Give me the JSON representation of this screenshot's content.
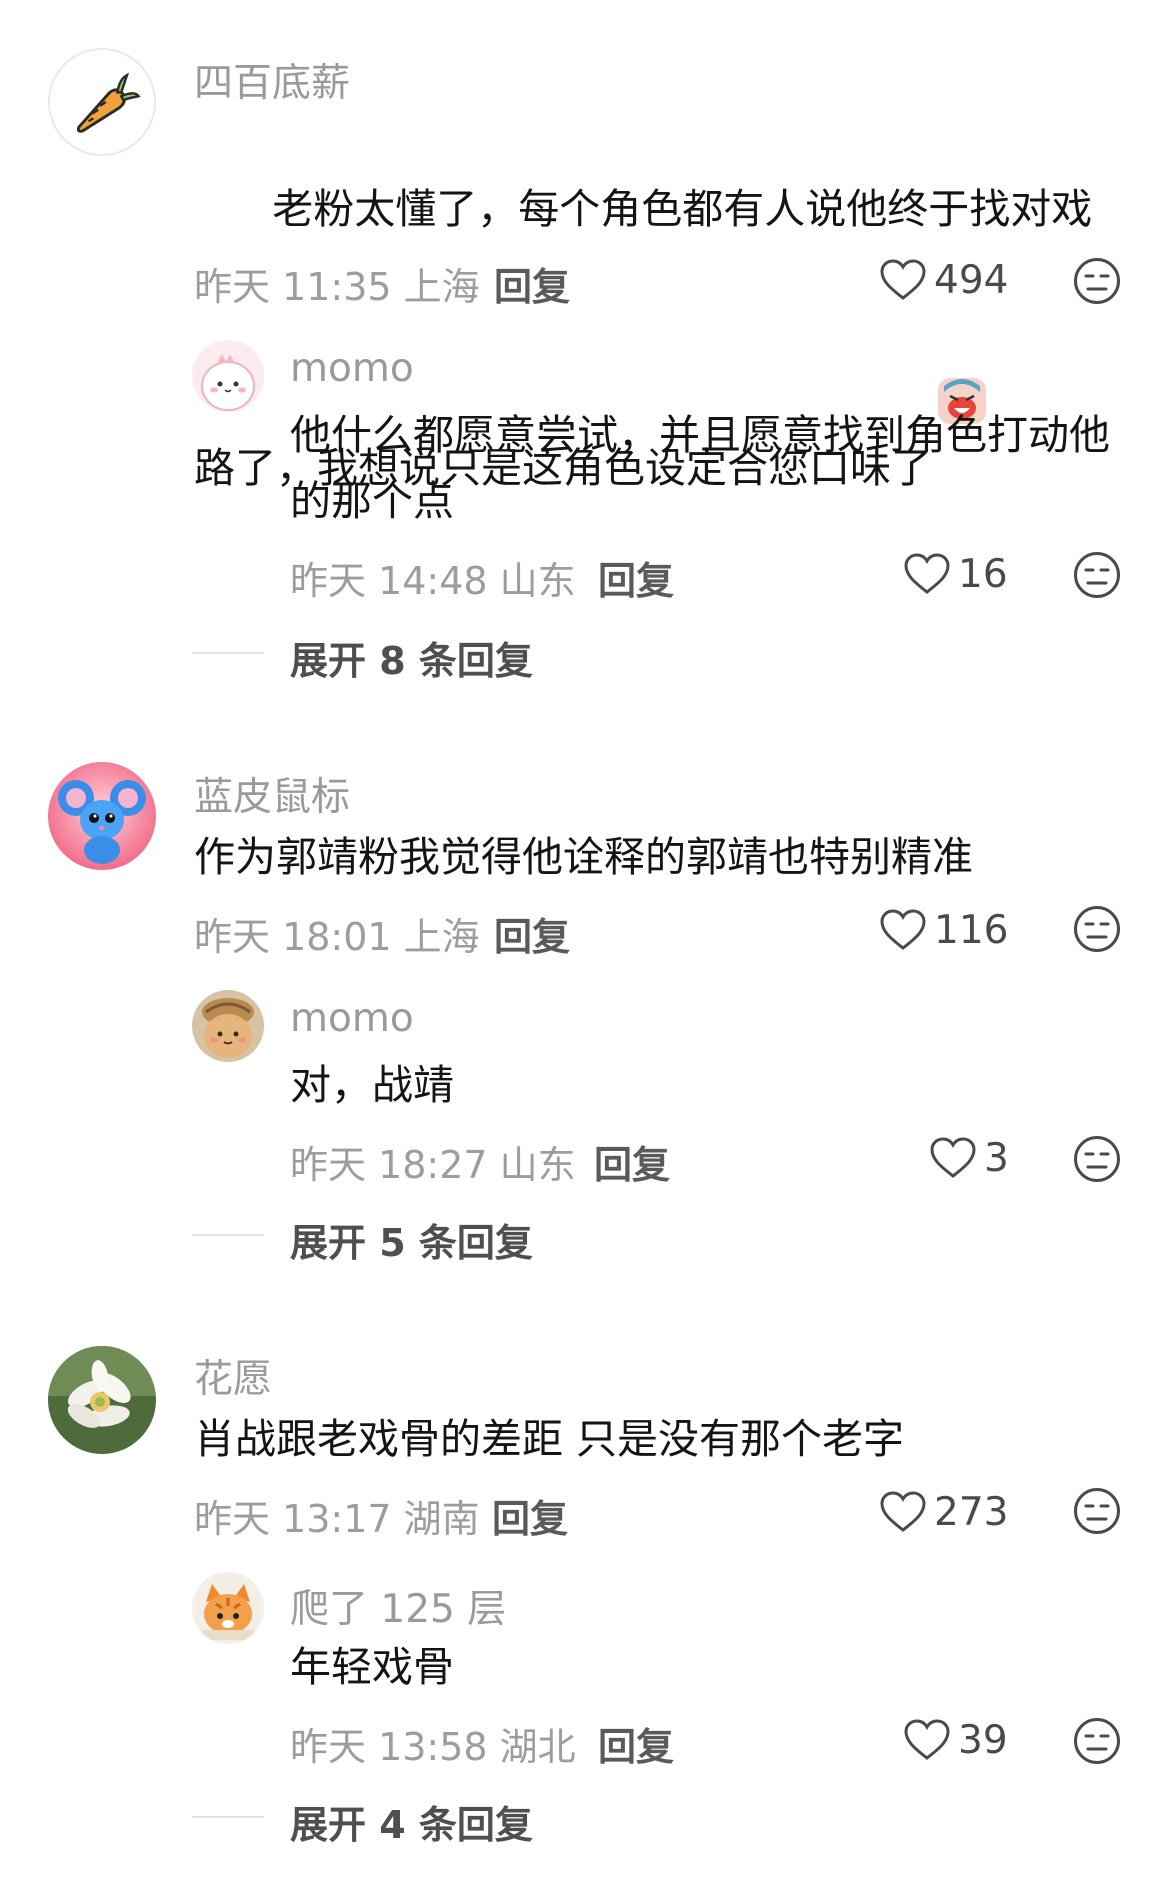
{
  "comments": [
    {
      "username": "四百底薪",
      "text": "老粉太懂了，每个角色都有人说他终于找对戏路了，我想说只是这角色设定合您口味了",
      "time": "昨天 11:35 上海",
      "reply_label": "回复",
      "likes": "494",
      "avatar_icon": "carrot-icon",
      "reply": {
        "username": "momo",
        "text": "他什么都愿意尝试，并且愿意找到角色打动他的那个点",
        "time": "昨天 14:48 山东",
        "reply_label": "回复",
        "likes": "16"
      },
      "expand_label": "展开 8 条回复"
    },
    {
      "username": "蓝皮鼠标",
      "text": "作为郭靖粉我觉得他诠释的郭靖也特别精准",
      "time": "昨天 18:01 上海",
      "reply_label": "回复",
      "likes": "116",
      "avatar_icon": "blue-mouse-icon",
      "reply": {
        "username": "momo",
        "text": "对，战靖",
        "time": "昨天 18:27 山东",
        "reply_label": "回复",
        "likes": "3"
      },
      "expand_label": "展开 5 条回复"
    },
    {
      "username": "花愿",
      "text": "肖战跟老戏骨的差距 只是没有那个老字",
      "time": "昨天 13:17 湖南",
      "reply_label": "回复",
      "likes": "273",
      "avatar_icon": "flower-icon",
      "reply": {
        "username": "爬了 125 层",
        "text": "年轻戏骨",
        "time": "昨天 13:58 湖北",
        "reply_label": "回复",
        "likes": "39"
      },
      "expand_label": "展开 4 条回复"
    }
  ],
  "colors": {
    "text": "#141414",
    "secondary": "#9a9a9a",
    "divider": "#e2e2e2"
  }
}
